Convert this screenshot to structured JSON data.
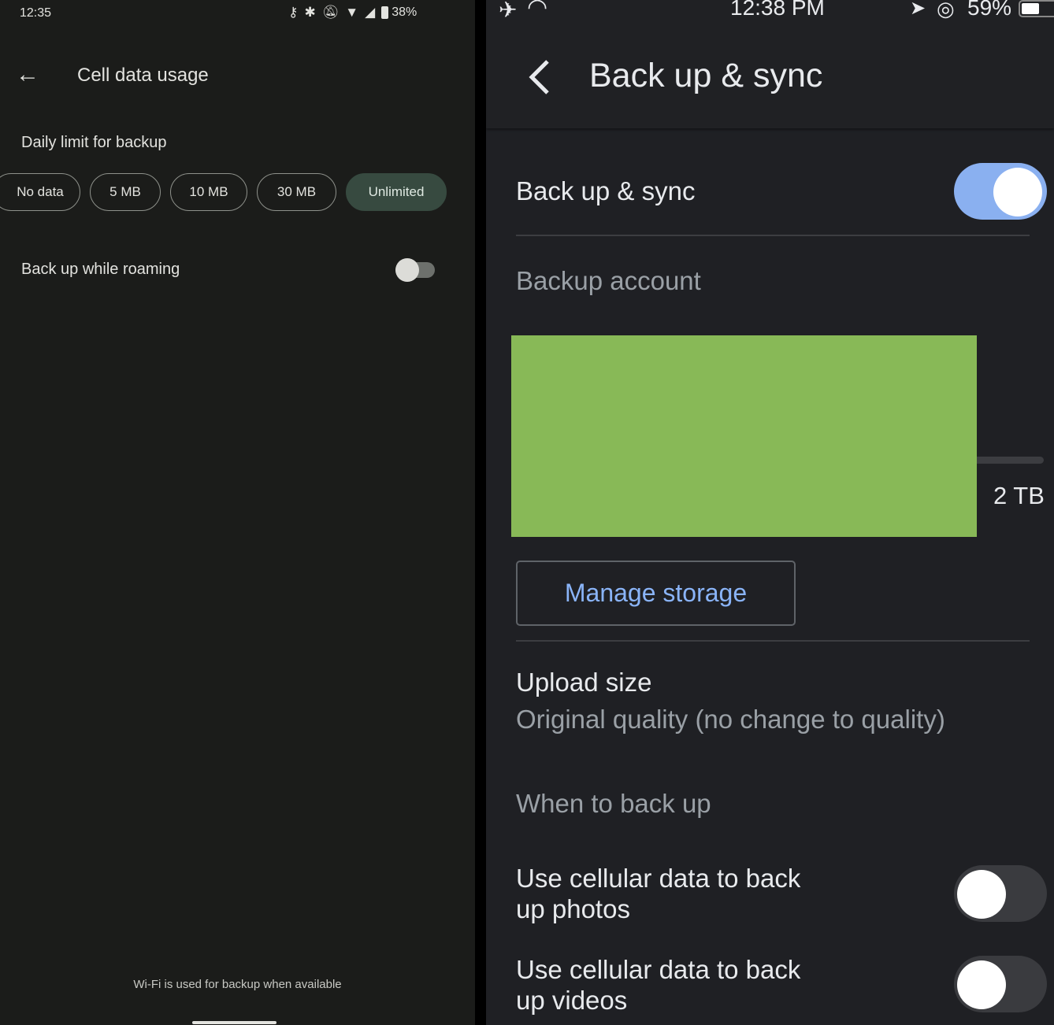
{
  "left": {
    "status": {
      "time": "12:35",
      "battery": "38%",
      "icons": [
        "vpn-key-icon",
        "bluetooth-icon",
        "notifications-off-icon",
        "wifi-icon",
        "cell-signal-icon",
        "battery-icon"
      ]
    },
    "header": {
      "title": "Cell data usage",
      "back_icon": "arrow-left-icon"
    },
    "daily_limit": {
      "label": "Daily limit for backup",
      "options": [
        "No data",
        "5 MB",
        "10 MB",
        "30 MB",
        "Unlimited"
      ],
      "selected": "Unlimited",
      "selected_color": "#374a40"
    },
    "roaming": {
      "label": "Back up while roaming",
      "enabled": false
    },
    "footer": "Wi-Fi is used for backup when available"
  },
  "right": {
    "status": {
      "time": "12:38 PM",
      "battery": "59%",
      "icons": [
        "airplane-icon",
        "wifi-icon",
        "location-icon",
        "rotation-lock-icon",
        "battery-icon"
      ]
    },
    "header": {
      "title": "Back up & sync",
      "back_icon": "chevron-left-icon"
    },
    "backup_sync": {
      "label": "Back up & sync",
      "enabled": true,
      "accent": "#8ab0f0"
    },
    "backup_account": {
      "label": "Backup account",
      "storage_total": "2 TB",
      "redaction_color": "#88b957"
    },
    "manage_storage": "Manage storage",
    "upload_size": {
      "label": "Upload size",
      "value": "Original quality (no change to quality)"
    },
    "when_to_backup": {
      "label": "When to back up",
      "items": [
        {
          "label1": "Use cellular data to back",
          "label2": "up photos",
          "enabled": false
        },
        {
          "label1": "Use cellular data to back",
          "label2": "up videos",
          "enabled": false
        }
      ]
    }
  }
}
